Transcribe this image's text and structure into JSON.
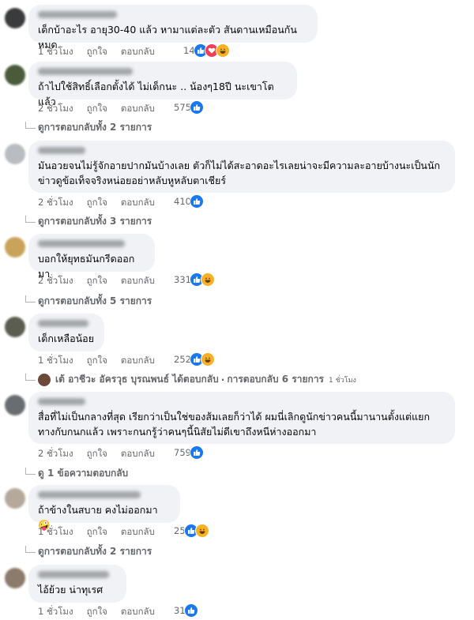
{
  "comments": [
    {
      "text": "เด็กบ้าอะไร อายุ30-40 แล้ว หามาแต่ละตัว สันดานเหมือนกันหมด",
      "time": "1 ชั่วโมง",
      "like": "ถูกใจ",
      "reply": "ตอบกลับ",
      "reaction_count": "14",
      "reaction_icons": [
        "like-icon",
        "love-icon",
        "haha-icon"
      ]
    },
    {
      "text": "ถ้าไปใช้สิทธิ์เลือกตั้งได้ ไม่เด็กนะ .. น้องๆ18ปี นะเขาโตแล้ว",
      "time": "2 ชั่วโมง",
      "like": "ถูกใจ",
      "reply": "ตอบกลับ",
      "reaction_count": "575",
      "reaction_icons": [
        "like-icon"
      ],
      "replies_label": "ดูการตอบกลับทั้ง 2 รายการ"
    },
    {
      "text": "มันอวยจนไม่รู้จักอายปากมันบ้างเลย ตัวก็ไม่ได้สะอาดอะไรเลยน่าจะมีความละอายบ้างนะเป็นนักข่าวดูข้อเท็จจริงหน่อยอย่าหลับหูหลับตาเชียร์",
      "time": "2 ชั่วโมง",
      "like": "ถูกใจ",
      "reply": "ตอบกลับ",
      "reaction_count": "410",
      "reaction_icons": [
        "like-icon"
      ],
      "replies_label": "ดูการตอบกลับทั้ง 3 รายการ"
    },
    {
      "text": "บอกให้ยุทธมันกรีดออกมา",
      "time": "2 ชั่วโมง",
      "like": "ถูกใจ",
      "reply": "ตอบกลับ",
      "reaction_count": "331",
      "reaction_icons": [
        "like-icon",
        "haha-icon"
      ],
      "replies_label": "ดูการตอบกลับทั้ง 5 รายการ"
    },
    {
      "text": "เด็กเหลือน้อย",
      "time": "1 ชั่วโมง",
      "like": "ถูกใจ",
      "reply": "ตอบกลับ",
      "reaction_count": "252",
      "reaction_icons": [
        "like-icon",
        "haha-icon"
      ],
      "reply_preview": {
        "author": "เต้ อาชีวะ อัครวุธ บุรณพนธ์",
        "action": "ได้ตอบกลับ",
        "separator": "·",
        "count_label": "การตอบกลับ 6 รายการ",
        "time": "1 ชั่วโมง"
      }
    },
    {
      "text": "สื่อที่ไม่เป็นกลางที่สุด เรียกว่าเป็นใช่ของส้มเลยก็ว่าได้ ผมนี่เลิกดูนักข่าวคนนี้มานานตั้งแต่แยกทางกับกนกแล้ว เพราะกนกรู้ว่าคนๆนี้นิสัยไม่ดีเขาถึงหนีห่างออกมา",
      "time": "2 ชั่วโมง",
      "like": "ถูกใจ",
      "reply": "ตอบกลับ",
      "reaction_count": "759",
      "reaction_icons": [
        "like-icon"
      ],
      "replies_label": "ดู 1 ข้อความตอบกลับ"
    },
    {
      "text": "ถ้าข้างในสบาย คงไม่ออกมา 🤪",
      "time": "1 ชั่วโมง",
      "like": "ถูกใจ",
      "reply": "ตอบกลับ",
      "reaction_count": "25",
      "reaction_icons": [
        "like-icon",
        "haha-icon"
      ],
      "replies_label": "ดูการตอบกลับทั้ง 2 รายการ"
    },
    {
      "text": "ไอ้ย้วย น่าทุเรศ",
      "time": "1 ชั่วโมง",
      "like": "ถูกใจ",
      "reply": "ตอบกลับ",
      "reaction_count": "31",
      "reaction_icons": [
        "like-icon"
      ]
    }
  ]
}
